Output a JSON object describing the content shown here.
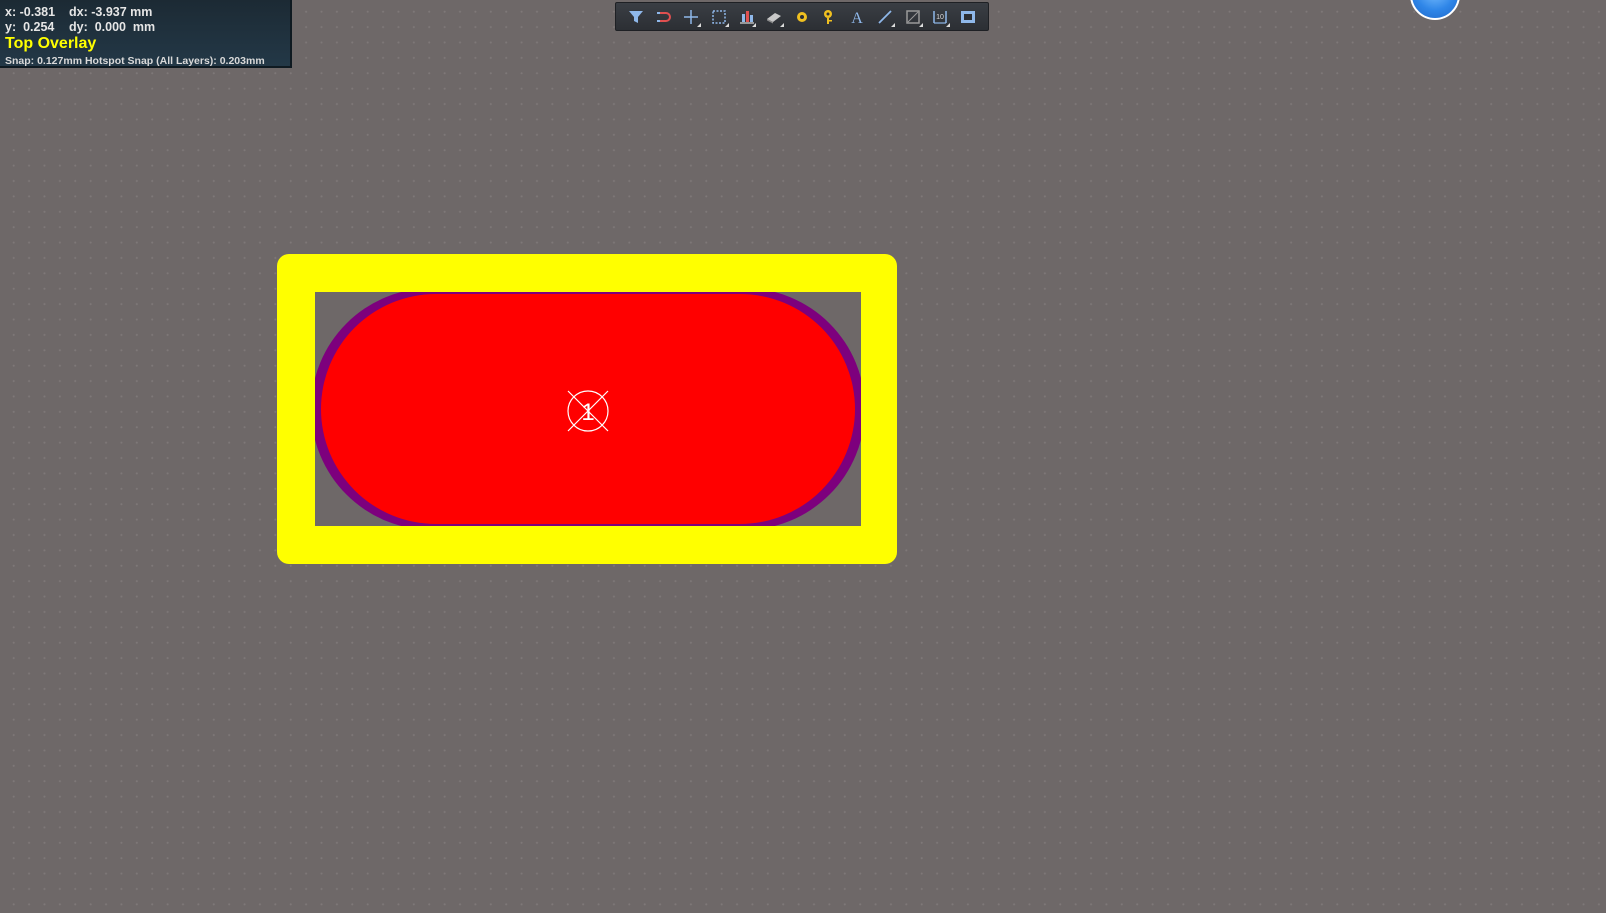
{
  "hud": {
    "x_label": "x:",
    "x_value": "-0.381",
    "dx_label": "dx:",
    "dx_value": "-3.937 mm",
    "y_label": "y:",
    "y_value": "0.254",
    "dy_label": "dy:",
    "dy_value": "0.000  mm",
    "layer": "Top Overlay",
    "snap": "Snap: 0.127mm Hotspot Snap (All Layers): 0.203mm"
  },
  "toolbar": {
    "tools": [
      {
        "icon": "filter-icon",
        "has_dropdown": false
      },
      {
        "icon": "interactive-routing-icon",
        "has_dropdown": false
      },
      {
        "icon": "crosshair-add-icon",
        "has_dropdown": true
      },
      {
        "icon": "select-rectangle-icon",
        "has_dropdown": true
      },
      {
        "icon": "align-icon",
        "has_dropdown": true
      },
      {
        "icon": "component-icon",
        "has_dropdown": true
      },
      {
        "icon": "pad-icon",
        "has_dropdown": false
      },
      {
        "icon": "via-icon",
        "has_dropdown": false
      },
      {
        "icon": "text-icon",
        "has_dropdown": false
      },
      {
        "icon": "line-icon",
        "has_dropdown": true
      },
      {
        "icon": "region-icon",
        "has_dropdown": true
      },
      {
        "icon": "dimension-icon",
        "has_dropdown": true
      },
      {
        "icon": "board-shape-icon",
        "has_dropdown": false
      }
    ]
  },
  "pad": {
    "designator": "1"
  },
  "colors": {
    "background": "#6e6868",
    "overlay": "#ffff00",
    "pad": "#ff0000",
    "solder_mask": "#7d007d",
    "hud_layer_text": "#ffff00",
    "toolbar_icon": "#8fb8ea"
  }
}
